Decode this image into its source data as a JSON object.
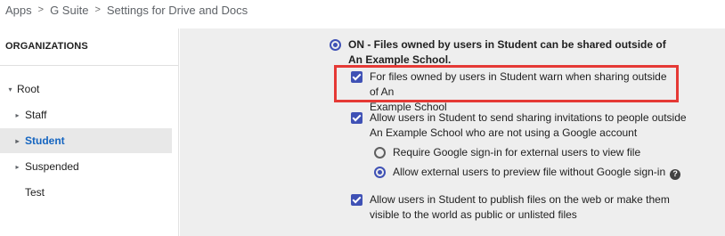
{
  "breadcrumb": {
    "items": [
      "Apps",
      "G Suite",
      "Settings for Drive and Docs"
    ],
    "separator": ">"
  },
  "sidebar": {
    "header": "ORGANIZATIONS",
    "items": [
      {
        "label": "Root",
        "expanded": true,
        "level": 0
      },
      {
        "label": "Staff",
        "expanded": false,
        "level": 1
      },
      {
        "label": "Student",
        "expanded": false,
        "level": 1,
        "selected": true
      },
      {
        "label": "Suspended",
        "expanded": false,
        "level": 1
      },
      {
        "label": "Test",
        "level": 1
      }
    ]
  },
  "settings": {
    "sharing_on": {
      "label_strong": "ON - Files owned by users in Student can be shared outside of An Example School.",
      "selected": true
    },
    "warn_option": {
      "line1": "For files owned by users in Student warn when sharing outside of An",
      "line2": "Example School",
      "checked": true
    },
    "invite_option": {
      "line1": "Allow users in Student to send sharing invitations to people outside",
      "line2": "An Example School who are not using a Google account",
      "checked": true
    },
    "require_signin": {
      "label": "Require Google sign-in for external users to view file",
      "selected": false
    },
    "allow_preview": {
      "label": "Allow external users to preview file without Google sign-in",
      "selected": true,
      "help_glyph": "?"
    },
    "publish_option": {
      "line1": "Allow users in Student to publish files on the web or make them",
      "line2": "visible to the world as public or unlisted files",
      "checked": true
    }
  },
  "colors": {
    "accent": "#3f51b5",
    "selected_text": "#1565c0",
    "highlight": "#e53935",
    "panel_bg": "#eeeeee"
  }
}
